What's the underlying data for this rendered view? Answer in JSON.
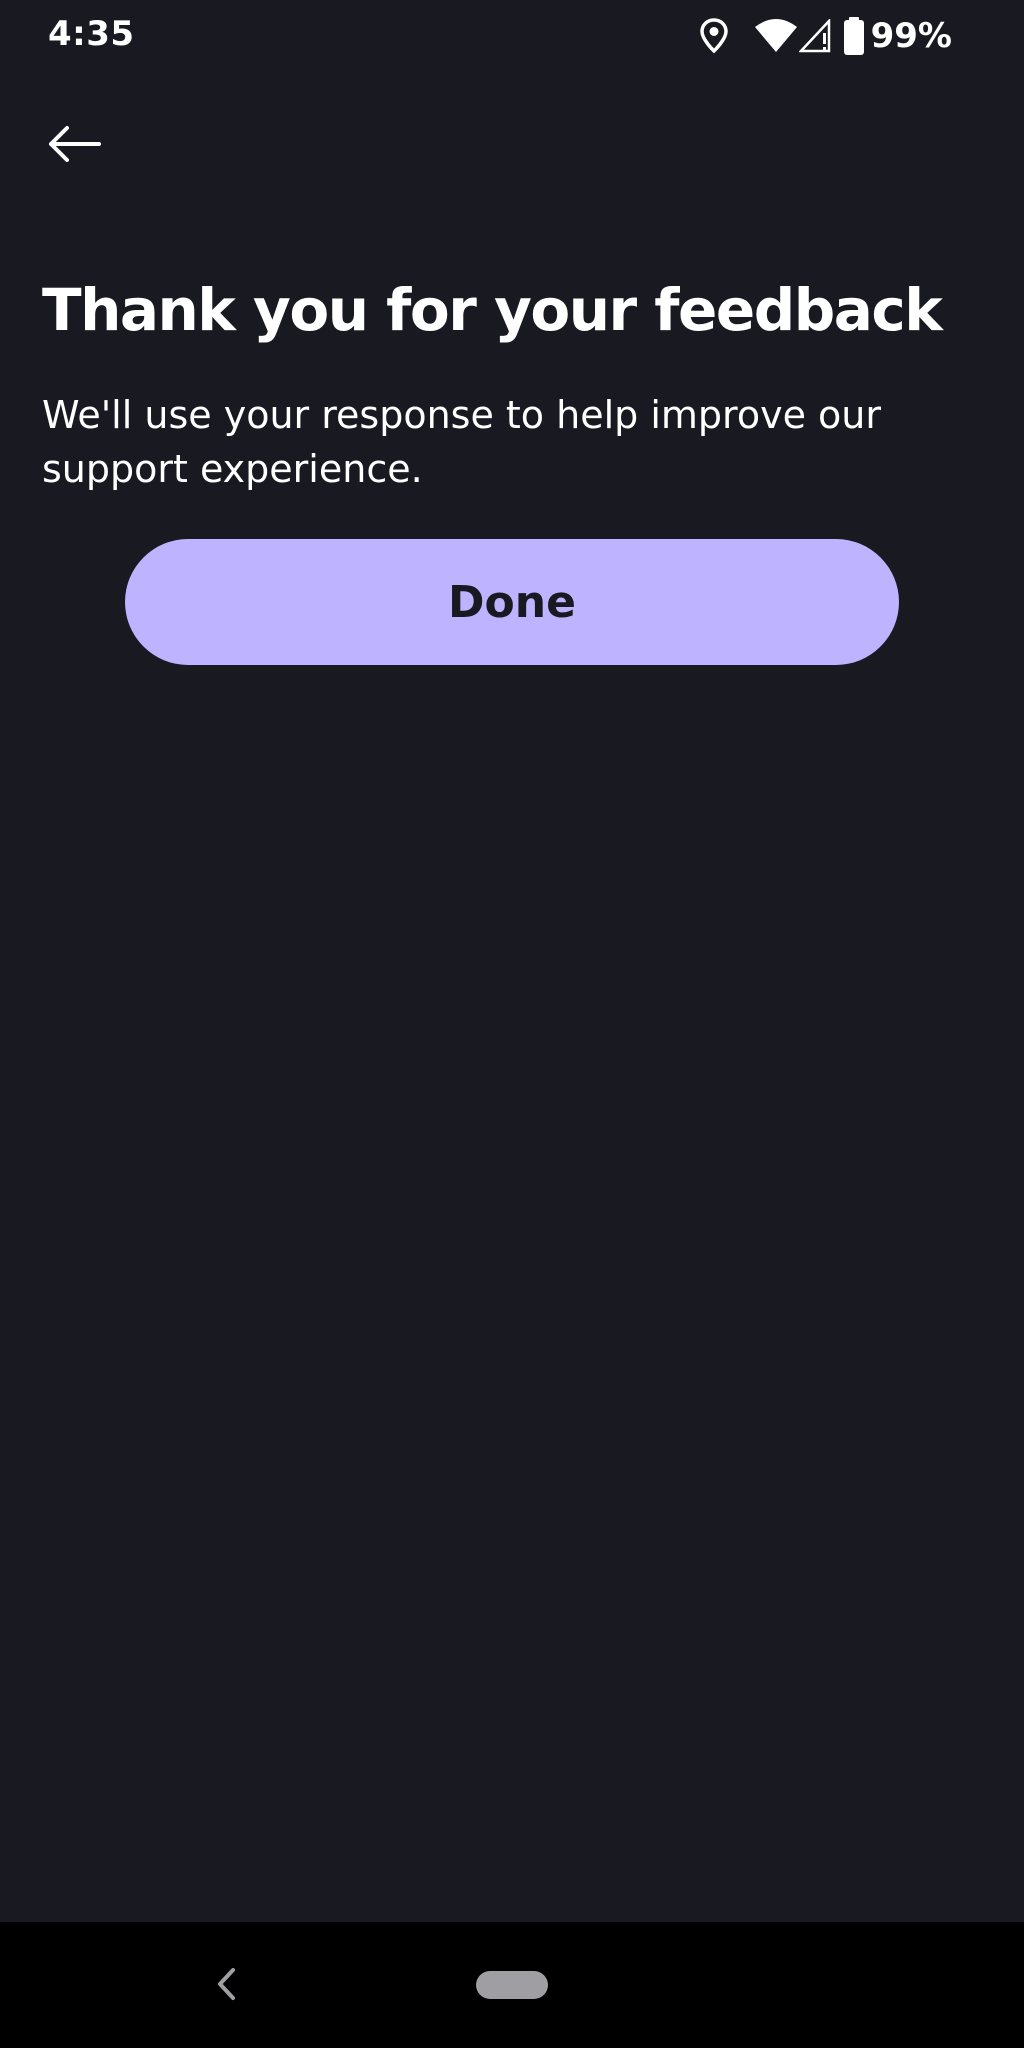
{
  "status_bar": {
    "time": "4:35",
    "battery_percent": "99%",
    "icons": [
      "location-icon",
      "wifi-icon",
      "signal-icon",
      "battery-icon"
    ]
  },
  "header": {
    "back_icon": "arrow-left-icon"
  },
  "main": {
    "title": "Thank you for your feedback",
    "description": "We'll use your response to help improve our support experience.",
    "done_label": "Done"
  },
  "nav_bar": {
    "back_icon": "chevron-left-icon",
    "home_icon": "home-pill-icon"
  },
  "colors": {
    "background": "#191922",
    "button": "#bdb3ff",
    "button_text": "#191922",
    "text": "#ffffff",
    "nav_bar": "#000000"
  }
}
